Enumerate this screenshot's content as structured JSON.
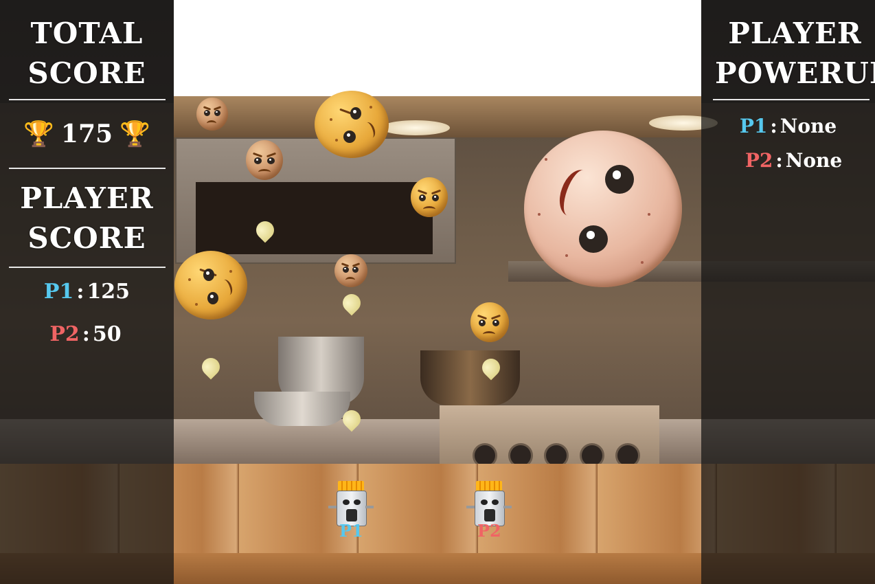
{
  "left_panel": {
    "total_score_heading_1": "TOTAL",
    "total_score_heading_2": "SCORE",
    "total_score_value": "175",
    "player_score_heading_1": "PLAYER",
    "player_score_heading_2": "SCORE",
    "p1_label": "P1",
    "p1_score": "125",
    "p2_label": "P2",
    "p2_score": "50",
    "separator": ":"
  },
  "right_panel": {
    "heading_1": "PLAYER",
    "heading_2": "POWERUP",
    "p1_label": "P1",
    "p1_powerup": "None",
    "p2_label": "P2",
    "p2_powerup": "None",
    "separator": ":"
  },
  "players": [
    {
      "label": "P1",
      "color": "#56c8ee"
    },
    {
      "label": "P2",
      "color": "#f06464"
    }
  ],
  "icons": {
    "trophy": "trophy-icon",
    "enemy": "potato-enemy",
    "projectile": "drop-projectile",
    "player": "fries-box-player"
  },
  "colors": {
    "p1": "#56c8ee",
    "p2": "#f06464",
    "panel_bg": "rgba(20,20,20,0.72)"
  }
}
